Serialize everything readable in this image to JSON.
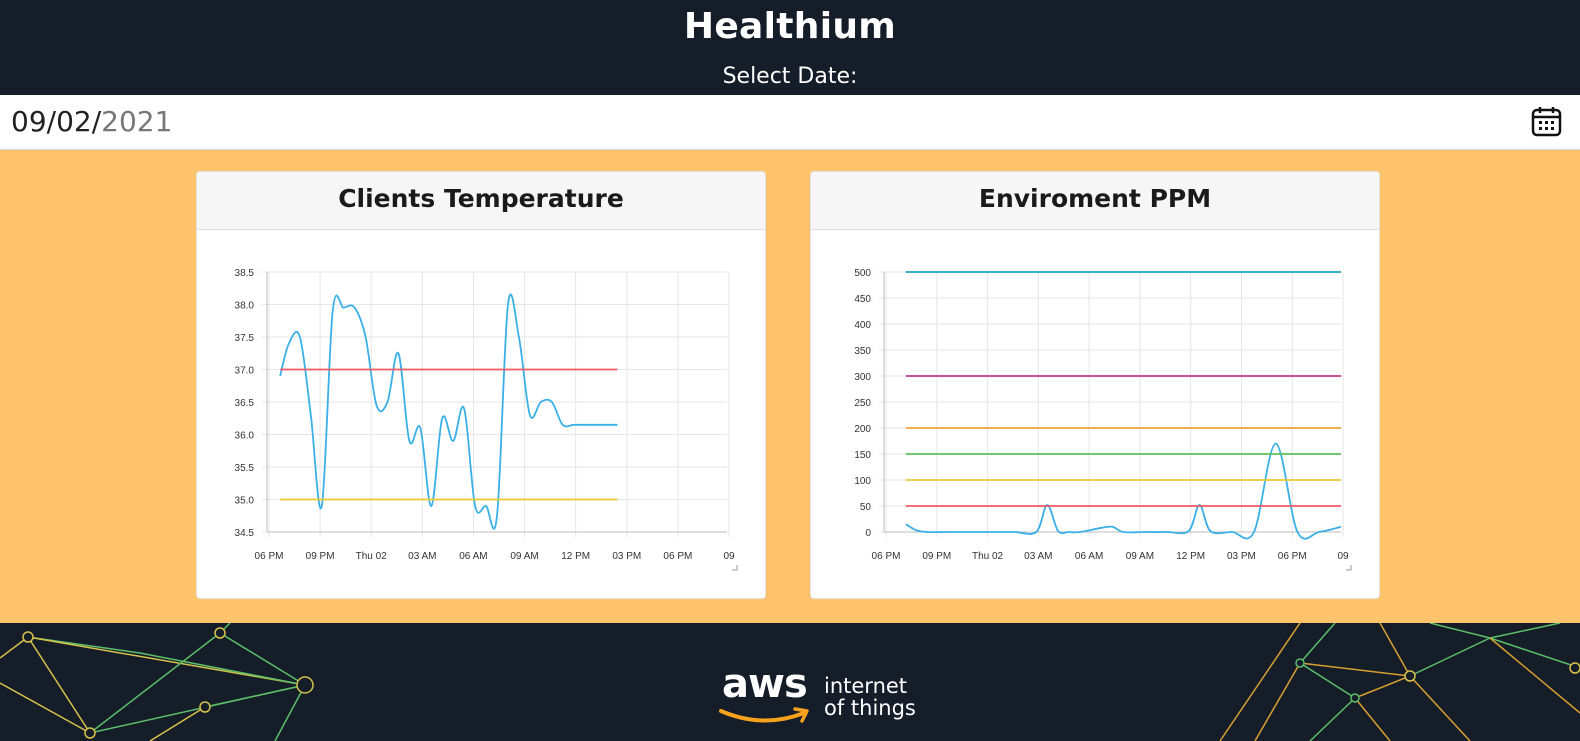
{
  "header": {
    "title": "Healthium",
    "select_label": "Select Date:"
  },
  "date_picker": {
    "month_day": "09/02/",
    "year": "2021",
    "icon": "calendar-icon"
  },
  "footer": {
    "aws": "aws",
    "line1": "internet",
    "line2": "of things"
  },
  "colors": {
    "header_bg": "#151d29",
    "page_bg": "#fec36b",
    "series_blue": "#3ab0e8",
    "red": "#f05a63",
    "yellow": "#e8c833",
    "teal": "#1aa8b8",
    "magenta": "#c03a8c",
    "orange": "#f0a038",
    "green": "#5cbf5a"
  },
  "chart_data": [
    {
      "type": "line",
      "title": "Clients Temperature",
      "x_ticks": [
        "06 PM",
        "09 PM",
        "Thu 02",
        "03 AM",
        "06 AM",
        "09 AM",
        "12 PM",
        "03 PM",
        "06 PM",
        "09"
      ],
      "y_ticks": [
        "34.5",
        "35.0",
        "35.5",
        "36.0",
        "36.5",
        "37.0",
        "37.5",
        "38.0",
        "38.5"
      ],
      "ylim": [
        34.5,
        38.5
      ],
      "x_hours": [
        0,
        21
      ],
      "series": [
        {
          "color": "#3ab0e8",
          "x": [
            0.6,
            1.0,
            1.5,
            2.0,
            2.5,
            3.0,
            3.5,
            4.0,
            4.5,
            5.0,
            5.5,
            6.0,
            6.5,
            7.0,
            7.5,
            8.0,
            8.5,
            9.0,
            9.5,
            10.0,
            10.5,
            11.0,
            11.5,
            12.0,
            12.5,
            13.0,
            13.5,
            14.0,
            14.5,
            15.0,
            15.5,
            16.0
          ],
          "y": [
            36.9,
            37.4,
            37.5,
            36.3,
            34.9,
            37.9,
            37.95,
            37.95,
            37.5,
            36.45,
            36.5,
            37.25,
            35.9,
            36.1,
            34.9,
            36.25,
            35.9,
            36.4,
            34.9,
            34.9,
            34.75,
            38.0,
            37.5,
            36.3,
            36.5,
            36.5,
            36.15,
            36.15,
            36.15,
            36.15,
            36.15,
            36.15
          ]
        },
        {
          "color": "#f05a63",
          "x": [
            0.6,
            16.0
          ],
          "y": [
            37.0,
            37.0
          ]
        },
        {
          "color": "#e8c833",
          "x": [
            0.6,
            16.0
          ],
          "y": [
            35.0,
            35.0
          ]
        }
      ]
    },
    {
      "type": "line",
      "title": "Enviroment PPM",
      "x_ticks": [
        "06 PM",
        "09 PM",
        "Thu 02",
        "03 AM",
        "06 AM",
        "09 AM",
        "12 PM",
        "03 PM",
        "06 PM",
        "09"
      ],
      "y_ticks": [
        "0",
        "50",
        "100",
        "150",
        "200",
        "250",
        "300",
        "350",
        "400",
        "450",
        "500"
      ],
      "ylim": [
        0,
        500
      ],
      "x_hours": [
        0,
        21
      ],
      "series": [
        {
          "color": "#3ab0e8",
          "x": [
            1.0,
            1.5,
            2.0,
            3.0,
            4.0,
            5.0,
            6.0,
            7.0,
            7.5,
            8.0,
            8.5,
            9.0,
            10.0,
            10.5,
            11.0,
            12.0,
            13.0,
            14.0,
            14.5,
            15.0,
            16.0,
            17.0,
            18.0,
            19.0,
            20.0,
            21.0
          ],
          "y": [
            15,
            3,
            0,
            0,
            0,
            0,
            0,
            0,
            52,
            2,
            0,
            0,
            8,
            10,
            0,
            0,
            0,
            2,
            52,
            2,
            0,
            0,
            170,
            0,
            0,
            10
          ]
        },
        {
          "color": "#1aa8b8",
          "x": [
            1.0,
            21.0
          ],
          "y": [
            500,
            500
          ]
        },
        {
          "color": "#c03a8c",
          "x": [
            1.0,
            21.0
          ],
          "y": [
            300,
            300
          ]
        },
        {
          "color": "#f0a038",
          "x": [
            1.0,
            21.0
          ],
          "y": [
            200,
            200
          ]
        },
        {
          "color": "#5cbf5a",
          "x": [
            1.0,
            21.0
          ],
          "y": [
            150,
            150
          ]
        },
        {
          "color": "#e8c833",
          "x": [
            1.0,
            21.0
          ],
          "y": [
            100,
            100
          ]
        },
        {
          "color": "#f05a63",
          "x": [
            1.0,
            21.0
          ],
          "y": [
            50,
            50
          ]
        }
      ]
    }
  ]
}
